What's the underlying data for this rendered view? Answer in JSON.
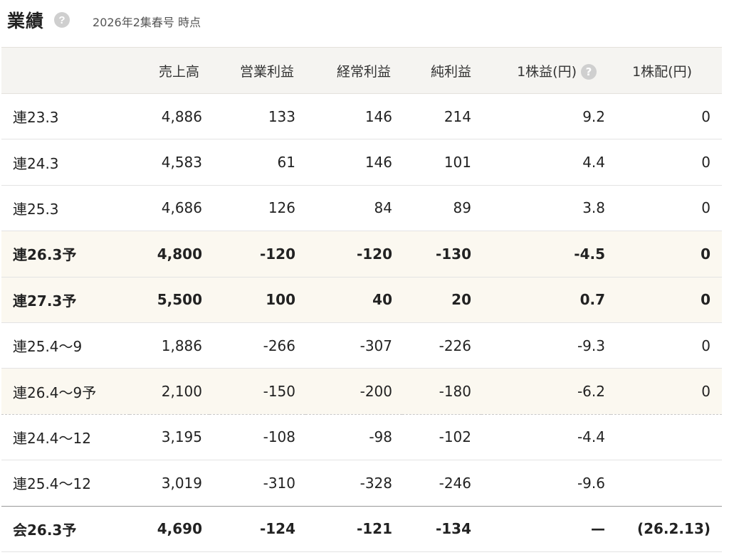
{
  "header": {
    "title": "業績",
    "help_icon": "?",
    "subtitle": "2026年2集春号 時点"
  },
  "table": {
    "columns": [
      "",
      "売上高",
      "営業利益",
      "経常利益",
      "純利益",
      "1株益(円)",
      "1株配(円)"
    ],
    "eps_help_icon": "?",
    "rows": [
      {
        "label": "連23.3",
        "sales": "4,886",
        "op": "133",
        "ord": "146",
        "net": "214",
        "eps": "9.2",
        "div": "0"
      },
      {
        "label": "連24.3",
        "sales": "4,583",
        "op": "61",
        "ord": "146",
        "net": "101",
        "eps": "4.4",
        "div": "0"
      },
      {
        "label": "連25.3",
        "sales": "4,686",
        "op": "126",
        "ord": "84",
        "net": "89",
        "eps": "3.8",
        "div": "0"
      },
      {
        "label": "連26.3予",
        "sales": "4,800",
        "op": "-120",
        "ord": "-120",
        "net": "-130",
        "eps": "-4.5",
        "div": "0"
      },
      {
        "label": "連27.3予",
        "sales": "5,500",
        "op": "100",
        "ord": "40",
        "net": "20",
        "eps": "0.7",
        "div": "0"
      },
      {
        "label": "連25.4〜9",
        "sales": "1,886",
        "op": "-266",
        "ord": "-307",
        "net": "-226",
        "eps": "-9.3",
        "div": "0"
      },
      {
        "label": "連26.4〜9予",
        "sales": "2,100",
        "op": "-150",
        "ord": "-200",
        "net": "-180",
        "eps": "-6.2",
        "div": "0"
      },
      {
        "label": "連24.4〜12",
        "sales": "3,195",
        "op": "-108",
        "ord": "-98",
        "net": "-102",
        "eps": "-4.4",
        "div": ""
      },
      {
        "label": "連25.4〜12",
        "sales": "3,019",
        "op": "-310",
        "ord": "-328",
        "net": "-246",
        "eps": "-9.6",
        "div": ""
      },
      {
        "label": "会26.3予",
        "sales": "4,690",
        "op": "-124",
        "ord": "-121",
        "net": "-134",
        "eps": "—",
        "div": "(26.2.13)"
      }
    ]
  },
  "colors": {
    "header_bg": "#f5f4f1",
    "forecast_bg": "#fbf8f0",
    "help_icon_bg": "#cfcfcf"
  }
}
